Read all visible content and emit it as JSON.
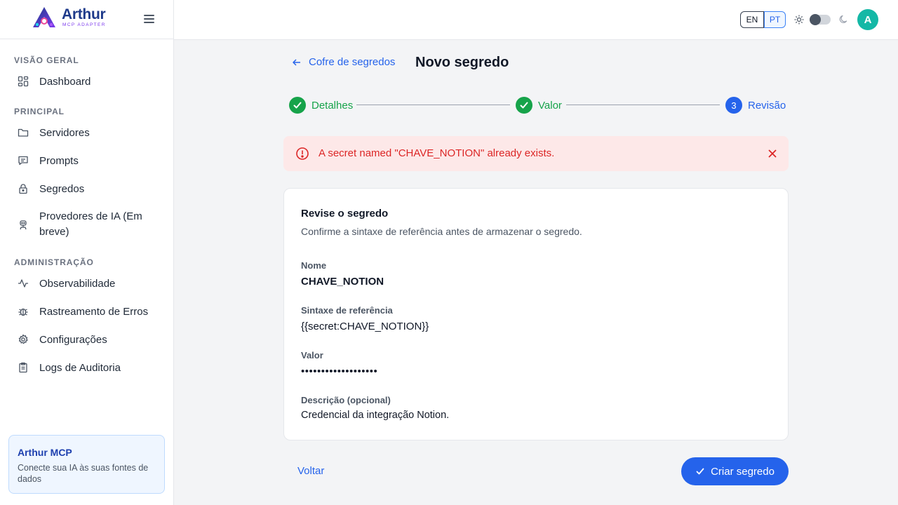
{
  "brand": {
    "name": "Arthur",
    "subtitle": "MCP ADAPTER"
  },
  "sidebar": {
    "sections": {
      "overview": "VISÃO GERAL",
      "main": "PRINCIPAL",
      "admin": "ADMINISTRAÇÃO"
    },
    "items": {
      "dashboard": "Dashboard",
      "servers": "Servidores",
      "prompts": "Prompts",
      "secrets": "Segredos",
      "ai_providers": "Provedores de IA (Em breve)",
      "observability": "Observabilidade",
      "error_tracking": "Rastreamento de Erros",
      "settings": "Configurações",
      "audit_logs": "Logs de Auditoria"
    },
    "promo": {
      "title": "Arthur MCP",
      "text": "Conecte sua IA às suas fontes de dados"
    }
  },
  "topbar": {
    "languages": [
      "EN",
      "PT"
    ],
    "selected_language": "PT",
    "theme": "light",
    "avatar_initial": "A"
  },
  "page": {
    "back_label": "Cofre de segredos",
    "title": "Novo segredo"
  },
  "stepper": {
    "steps": [
      {
        "label": "Detalhes",
        "status": "done"
      },
      {
        "label": "Valor",
        "status": "done"
      },
      {
        "label": "Revisão",
        "status": "active",
        "number": "3"
      }
    ]
  },
  "alert": {
    "message": "A secret named \"CHAVE_NOTION\" already exists."
  },
  "review": {
    "title": "Revise o segredo",
    "subtitle": "Confirme a sintaxe de referência antes de armazenar o segredo.",
    "fields": [
      {
        "label": "Nome",
        "value": "CHAVE_NOTION"
      },
      {
        "label": "Sintaxe de referência",
        "value": "{{secret:CHAVE_NOTION}}"
      },
      {
        "label": "Valor",
        "value": "•••••••••••••••••••"
      },
      {
        "label": "Descrição (opcional)",
        "value": "Credencial da integração Notion."
      }
    ]
  },
  "actions": {
    "back": "Voltar",
    "create": "Criar segredo"
  },
  "colors": {
    "primary": "#2563eb",
    "success": "#16a34a",
    "danger": "#dc2626",
    "avatar": "#14b8a6"
  }
}
